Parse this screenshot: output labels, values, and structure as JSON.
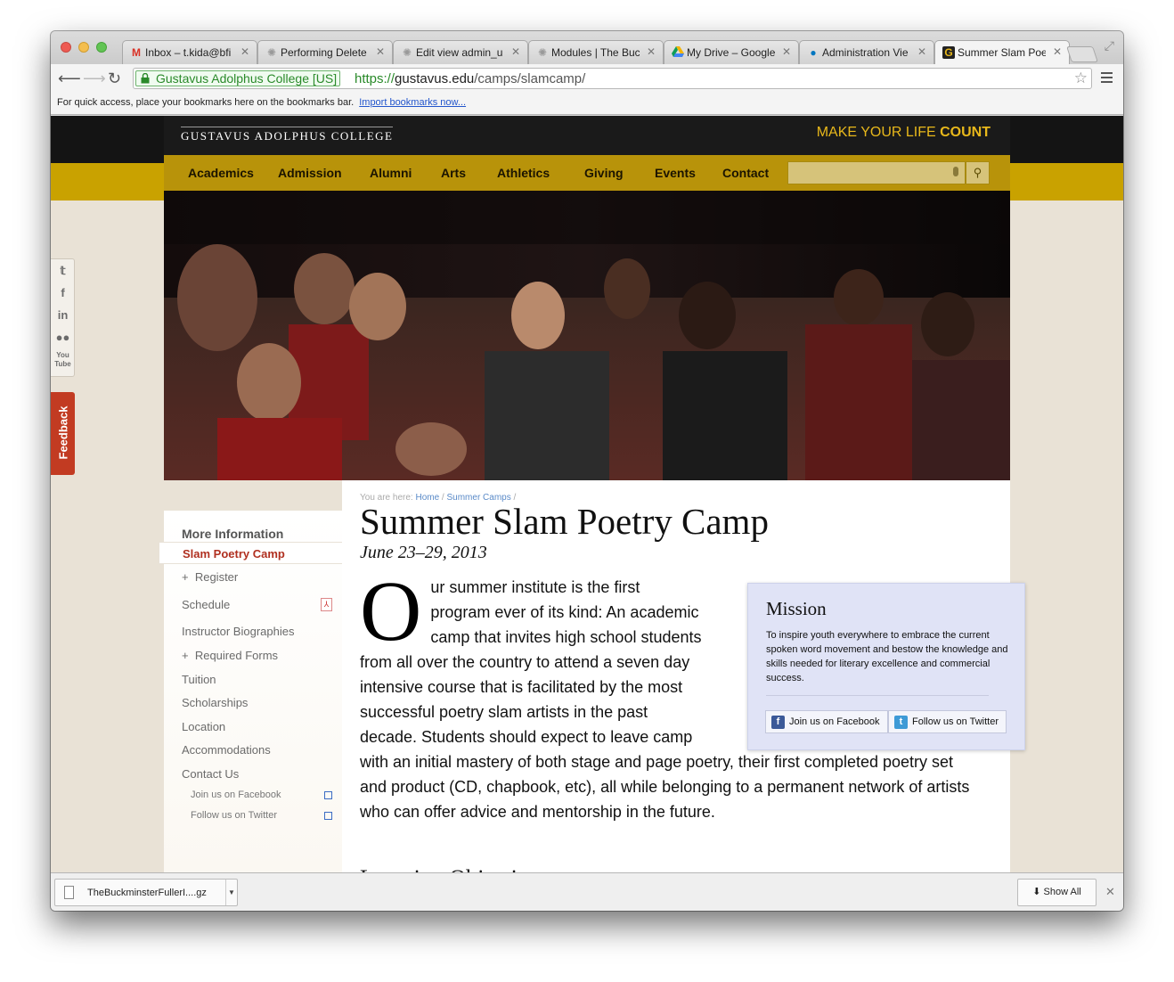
{
  "browser": {
    "tabs": [
      {
        "title": "Inbox – t.kida@bfi",
        "icon": "gmail-icon",
        "active": false
      },
      {
        "title": "Performing Delete",
        "icon": "drupal-page-icon",
        "active": false
      },
      {
        "title": "Edit view admin_u",
        "icon": "drupal-page-icon",
        "active": false
      },
      {
        "title": "Modules | The Buc",
        "icon": "drupal-page-icon",
        "active": false
      },
      {
        "title": "My Drive – Google",
        "icon": "google-drive-icon",
        "active": false
      },
      {
        "title": "Administration Vie",
        "icon": "drupal-icon",
        "active": false
      },
      {
        "title": "Summer Slam Poet",
        "icon": "gustavus-icon",
        "active": true
      }
    ],
    "ev_name": "Gustavus Adolphus College [US]",
    "url_scheme": "https://",
    "url_host": "gustavus.edu",
    "url_path": "/camps/slamcamp/",
    "bookmarks_prompt": "For quick access, place your bookmarks here on the bookmarks bar.",
    "bookmarks_link": "Import bookmarks now..."
  },
  "site": {
    "college_name": "GUSTAVUS ADOLPHUS COLLEGE",
    "tagline_prefix": "MAKE YOUR LIFE ",
    "tagline_bold": "COUNT",
    "nav": [
      "Academics",
      "Admission",
      "Alumni",
      "Arts",
      "Athletics",
      "Giving",
      "Events",
      "Contact"
    ],
    "search_placeholder": "",
    "feedback_label": "Feedback",
    "social_icons": [
      "twitter-icon",
      "facebook-icon",
      "linkedin-icon",
      "flickr-icon",
      "youtube-icon"
    ]
  },
  "sidebar": {
    "heading": "More Information",
    "active": "Slam Poetry Camp",
    "items": [
      {
        "label": "Register",
        "expandable": true
      },
      {
        "label": "Schedule",
        "icon": "pdf-icon"
      },
      {
        "label": "Instructor Biographies"
      },
      {
        "label": "Required Forms",
        "expandable": true
      },
      {
        "label": "Tuition"
      },
      {
        "label": "Scholarships"
      },
      {
        "label": "Location"
      },
      {
        "label": "Accommodations"
      },
      {
        "label": "Contact Us"
      }
    ],
    "subitems": [
      {
        "label": "Join us on Facebook",
        "icon": "external-link-icon"
      },
      {
        "label": "Follow us on Twitter",
        "icon": "external-link-icon"
      }
    ]
  },
  "content": {
    "breadcrumb_prefix": "You are here: ",
    "breadcrumb": [
      "Home",
      "Summer Camps"
    ],
    "title": "Summer Slam Poetry Camp",
    "date": "June 23–29, 2013",
    "dropcap": "O",
    "body": "ur summer institute is the first program ever of its kind: An academic camp that invites high school students from all over the country to attend a seven day intensive course that is facilitated by the most successful poetry slam artists in the past decade. Students should expect to leave camp with an initial mastery of both stage and page poetry, their first completed poetry set and product (CD, chapbook, etc), all while belonging to a permanent network of artists who can offer advice and mentorship in the future.",
    "next_heading": "Learning Objectives",
    "mission": {
      "title": "Mission",
      "text": "To inspire youth everywhere to embrace the current spoken word movement and bestow the knowledge and skills needed for literary excellence and commercial success.",
      "facebook_button": "Join us on Facebook",
      "twitter_button": "Follow us on Twitter"
    }
  },
  "downloads": {
    "file": "TheBuckminsterFullerI....gz",
    "show_all": "Show All"
  },
  "colors": {
    "gold": "#c9a200",
    "nav_gold": "#b8930a",
    "accent_red": "#b03020",
    "feedback_red": "#c23b22",
    "mission_bg": "#e0e3f6"
  }
}
